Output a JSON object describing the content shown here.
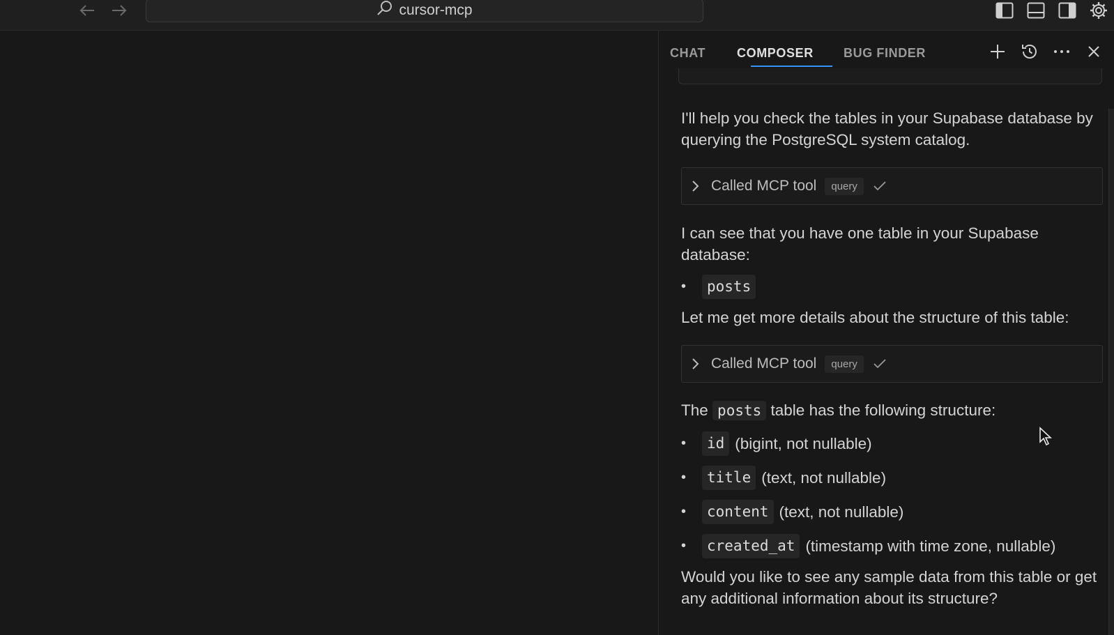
{
  "titlebar": {
    "search_text": "cursor-mcp",
    "icons": [
      "arrow-left-icon",
      "arrow-right-icon",
      "search-icon",
      "toggle-primary-sidebar-icon",
      "toggle-panel-icon",
      "toggle-secondary-sidebar-icon",
      "settings-gear-icon"
    ]
  },
  "panel": {
    "tabs": [
      {
        "label": "CHAT",
        "active": false
      },
      {
        "label": "COMPOSER",
        "active": true
      },
      {
        "label": "BUG FINDER",
        "active": false
      }
    ],
    "actions": [
      "plus-icon",
      "history-icon",
      "more-icon",
      "close-icon"
    ],
    "accent_color": "#3794ff"
  },
  "messages": {
    "intro": "I'll help you check the tables in your Supabase database by querying the PostgreSQL system catalog.",
    "tool_call_1": {
      "label": "Called MCP tool",
      "badge": "query"
    },
    "found": "I can see that you have one table in your Supabase database:",
    "tables": [
      "posts"
    ],
    "more_details": "Let me get more details about the structure of this table:",
    "tool_call_2": {
      "label": "Called MCP tool",
      "badge": "query"
    },
    "structure_pre": "The",
    "structure_code": "posts",
    "structure_post": "table has the following structure:",
    "columns": [
      {
        "name": "id",
        "desc": "(bigint, not nullable)"
      },
      {
        "name": "title",
        "desc": "(text, not nullable)"
      },
      {
        "name": "content",
        "desc": "(text, not nullable)"
      },
      {
        "name": "created_at",
        "desc": "(timestamp with time zone, nullable)"
      }
    ],
    "followup": "Would you like to see any sample data from this table or get any additional information about its structure?"
  }
}
